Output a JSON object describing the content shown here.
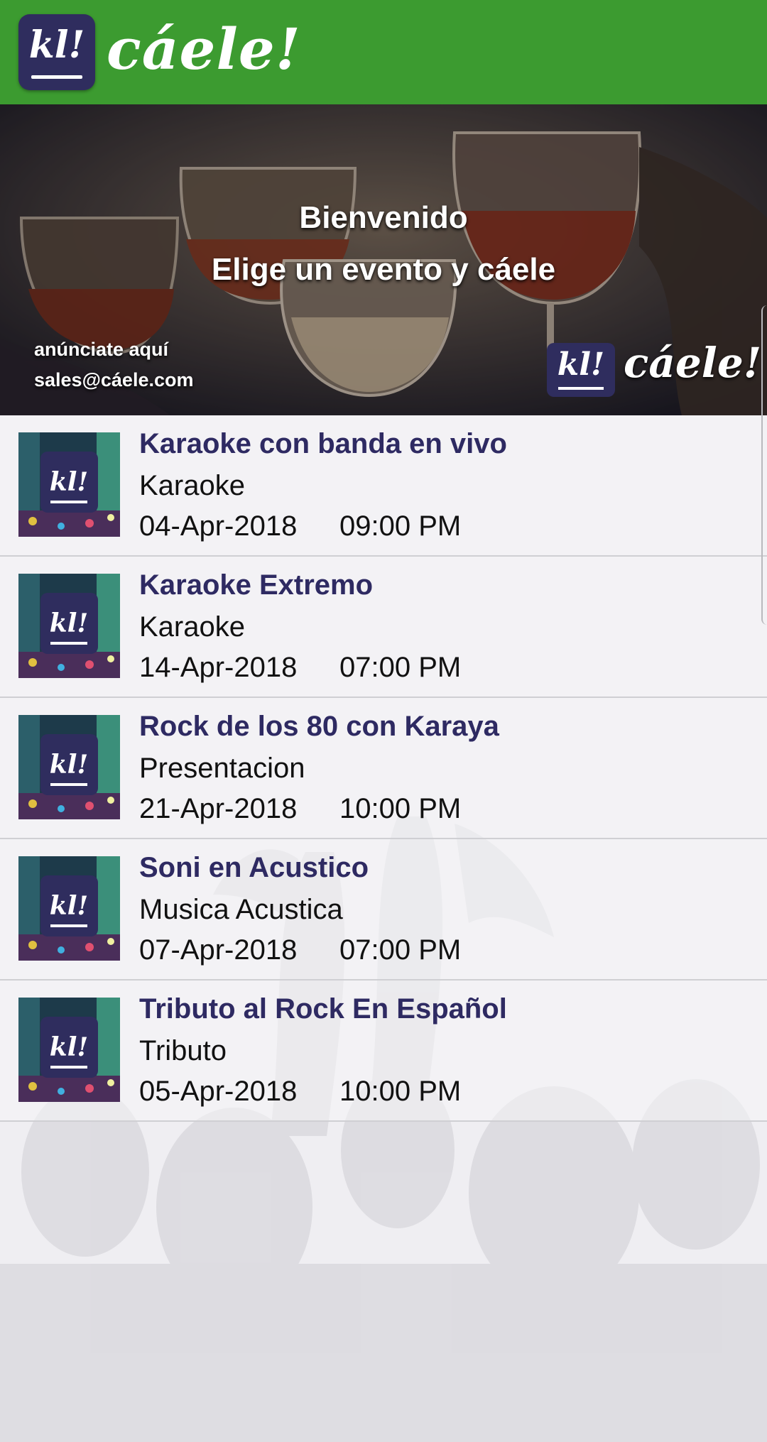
{
  "header": {
    "logo_text": "kl!",
    "wordmark": "cáele!"
  },
  "banner": {
    "welcome": "Bienvenido",
    "tagline": "Elige un evento y cáele",
    "ad_line1": "anúnciate aquí",
    "ad_line2": "sales@cáele.com",
    "logo_text": "kl!",
    "wordmark": "cáele!"
  },
  "events": [
    {
      "title": "Karaoke con banda en vivo",
      "type": "Karaoke",
      "date": "04-Apr-2018",
      "time": "09:00 PM",
      "thumb_logo": "kl!"
    },
    {
      "title": "Karaoke Extremo",
      "type": "Karaoke",
      "date": "14-Apr-2018",
      "time": "07:00 PM",
      "thumb_logo": "kl!"
    },
    {
      "title": "Rock de los 80 con Karaya",
      "type": "Presentacion",
      "date": "21-Apr-2018",
      "time": "10:00 PM",
      "thumb_logo": "kl!"
    },
    {
      "title": "Soni en Acustico",
      "type": "Musica Acustica",
      "date": "07-Apr-2018",
      "time": "07:00 PM",
      "thumb_logo": "kl!"
    },
    {
      "title": "Tributo al Rock En Español",
      "type": "Tributo",
      "date": "05-Apr-2018",
      "time": "10:00 PM",
      "thumb_logo": "kl!"
    }
  ],
  "colors": {
    "header_green": "#3c9b30",
    "brand_purple": "#2f2d5e",
    "title_purple": "#2e2a62"
  }
}
